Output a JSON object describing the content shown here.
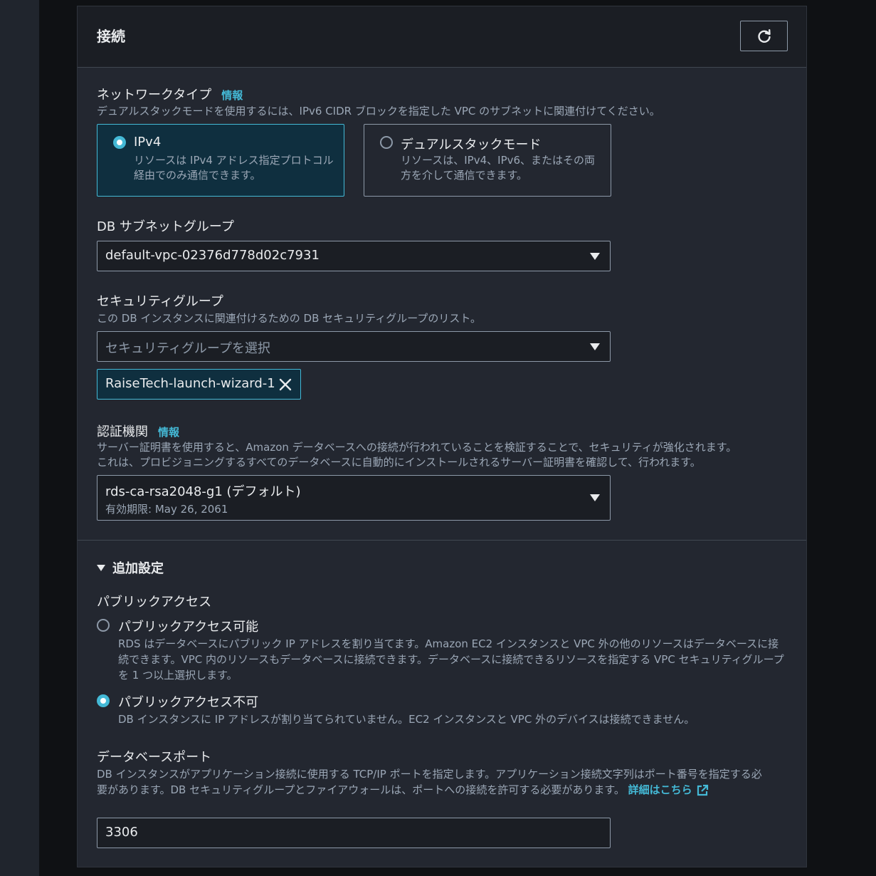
{
  "section": {
    "title": "接続"
  },
  "network_type": {
    "label": "ネットワークタイプ",
    "info": "情報",
    "description": "デュアルスタックモードを使用するには、IPv6 CIDR ブロックを指定した VPC のサブネットに関連付けてください。",
    "options": [
      {
        "title": "IPv4",
        "description": "リソースは IPv4 アドレス指定プロトコル経由でのみ通信できます。",
        "selected": true
      },
      {
        "title": "デュアルスタックモード",
        "description": "リソースは、IPv4、IPv6、またはその両方を介して通信できます。",
        "selected": false
      }
    ]
  },
  "subnet_group": {
    "label": "DB サブネットグループ",
    "value": "default-vpc-02376d778d02c7931"
  },
  "security_group": {
    "label": "セキュリティグループ",
    "description": "この DB インスタンスに関連付けるための DB セキュリティグループのリスト。",
    "placeholder": "セキュリティグループを選択",
    "tokens": [
      "RaiseTech-launch-wizard-1"
    ]
  },
  "certificate_authority": {
    "label": "認証機関",
    "info": "情報",
    "description_1": "サーバー証明書を使用すると、Amazon データベースへの接続が行われていることを検証することで、セキュリティが強化されます。",
    "description_2": "これは、プロビジョニングするすべてのデータベースに自動的にインストールされるサーバー証明書を確認して、行われます。",
    "value": "rds-ca-rsa2048-g1 (デフォルト)",
    "sub_value": "有効期限: May 26, 2061"
  },
  "additional": {
    "title": "追加設定",
    "public_access": {
      "label": "パブリックアクセス",
      "options": [
        {
          "title": "パブリックアクセス可能",
          "description": "RDS はデータベースにパブリック IP アドレスを割り当てます。Amazon EC2 インスタンスと VPC 外の他のリソースはデータベースに接続できます。VPC 内のリソースもデータベースに接続できます。データベースに接続できるリソースを指定する VPC セキュリティグループを 1 つ以上選択します。",
          "selected": false
        },
        {
          "title": "パブリックアクセス不可",
          "description": "DB インスタンスに IP アドレスが割り当てられていません。EC2 インスタンスと VPC 外のデバイスは接続できません。",
          "selected": true
        }
      ]
    },
    "port": {
      "label": "データベースポート",
      "description": "DB インスタンスがアプリケーション接続に使用する TCP/IP ポートを指定します。アプリケーション接続文字列はポート番号を指定する必要があります。DB セキュリティグループとファイアウォールは、ポートへの接続を許可する必要があります。",
      "link": "詳細はこちら",
      "value": "3306"
    }
  },
  "colors": {
    "accent": "#44b9d6",
    "panel": "#232730",
    "header": "#1b1e24"
  }
}
